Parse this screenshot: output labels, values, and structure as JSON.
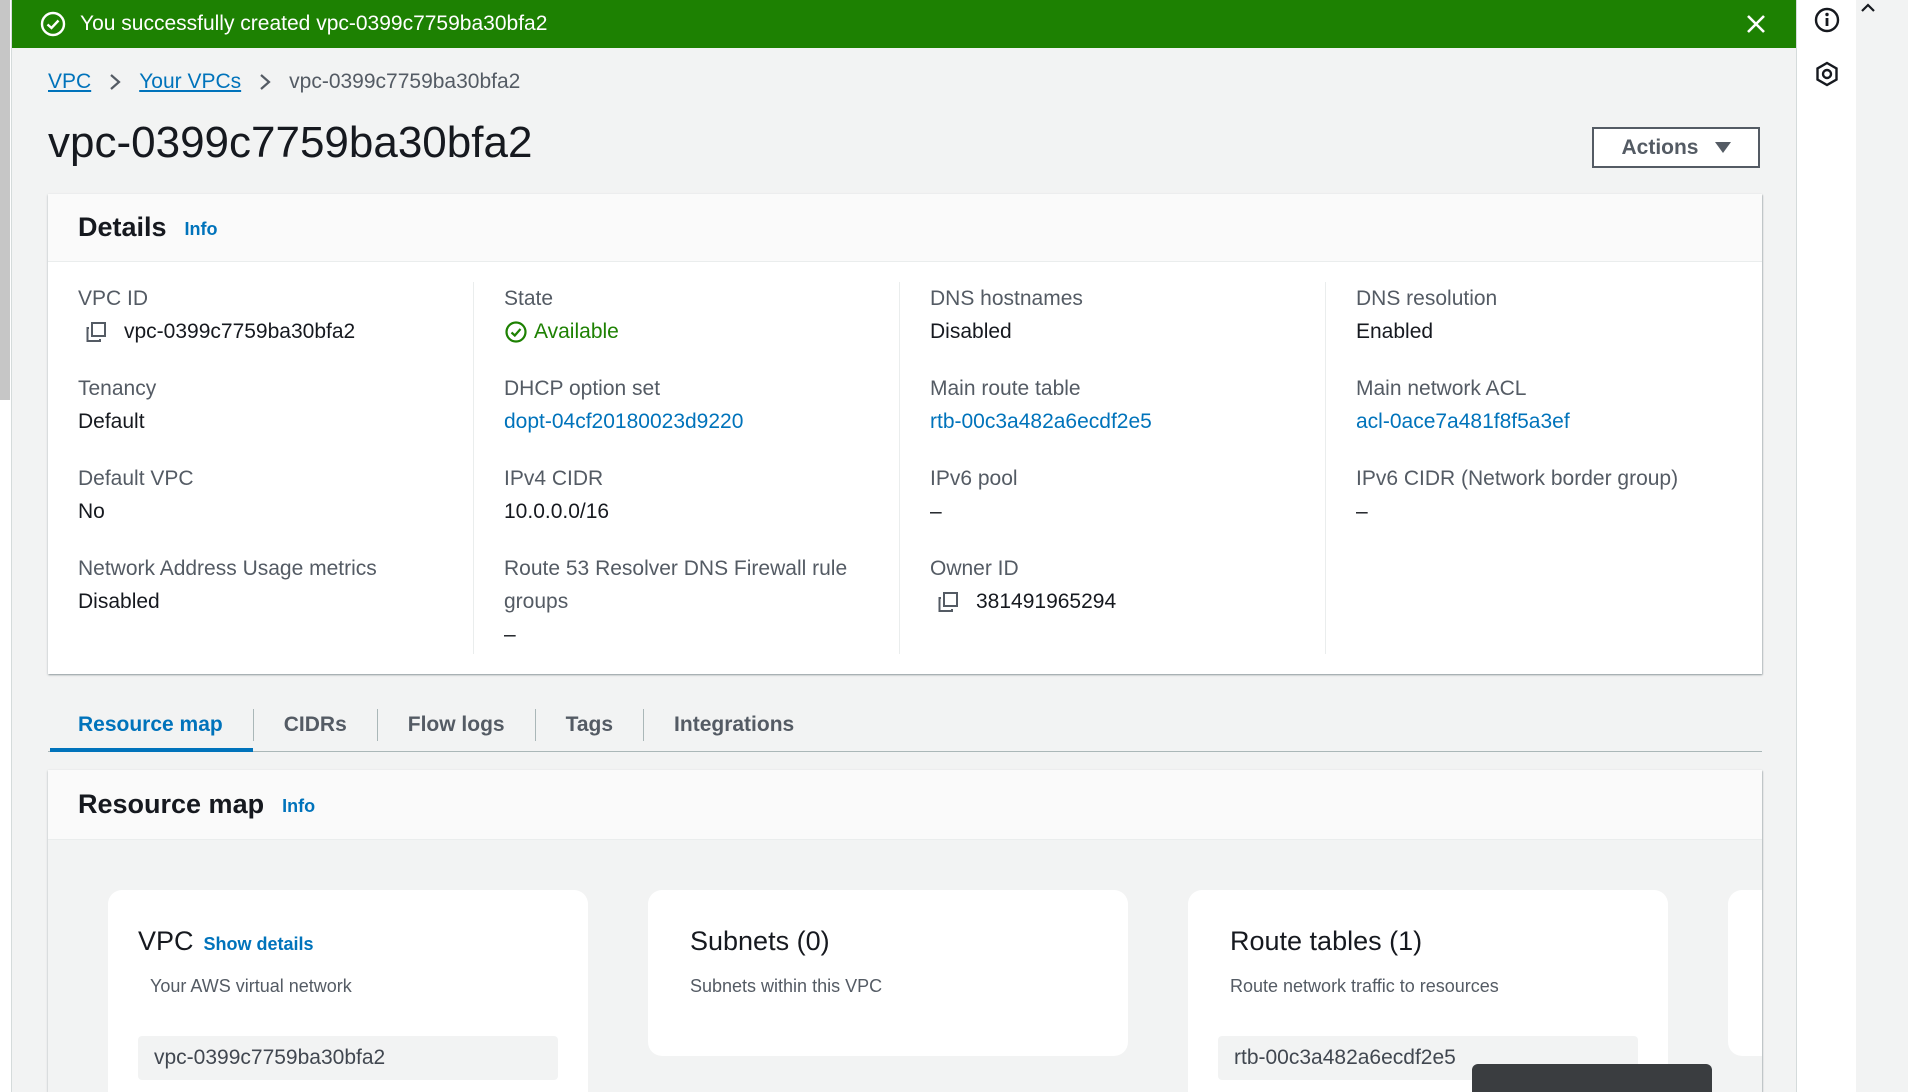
{
  "flash": {
    "message": "You successfully created vpc-0399c7759ba30bfa2",
    "color": "#1d8102"
  },
  "breadcrumb": {
    "items": [
      "VPC",
      "Your VPCs"
    ],
    "current": "vpc-0399c7759ba30bfa2"
  },
  "page": {
    "title": "vpc-0399c7759ba30bfa2",
    "actions_label": "Actions"
  },
  "details": {
    "heading": "Details",
    "info_label": "Info",
    "columns": [
      [
        {
          "label": "VPC ID",
          "value": "vpc-0399c7759ba30bfa2"
        },
        {
          "label": "Tenancy",
          "value": "Default"
        },
        {
          "label": "Default VPC",
          "value": "No"
        },
        {
          "label": "Network Address Usage metrics",
          "value": "Disabled"
        }
      ],
      [
        {
          "label": "State",
          "value": "Available"
        },
        {
          "label": "DHCP option set",
          "value": "dopt-04cf20180023d9220"
        },
        {
          "label": "IPv4 CIDR",
          "value": "10.0.0.0/16"
        },
        {
          "label": "Route 53 Resolver DNS Firewall rule groups",
          "value": "–"
        }
      ],
      [
        {
          "label": "DNS hostnames",
          "value": "Disabled"
        },
        {
          "label": "Main route table",
          "value": "rtb-00c3a482a6ecdf2e5"
        },
        {
          "label": "IPv6 pool",
          "value": "–"
        },
        {
          "label": "Owner ID",
          "value": "381491965294"
        }
      ],
      [
        {
          "label": "DNS resolution",
          "value": "Enabled"
        },
        {
          "label": "Main network ACL",
          "value": "acl-0ace7a481f8f5a3ef"
        },
        {
          "label": "IPv6 CIDR (Network border group)",
          "value": "–"
        }
      ]
    ]
  },
  "tabs": [
    "Resource map",
    "CIDRs",
    "Flow logs",
    "Tags",
    "Integrations"
  ],
  "resource_map": {
    "heading": "Resource map",
    "info_label": "Info",
    "cards": [
      {
        "title": "VPC",
        "link": "Show details",
        "subtitle": "Your AWS virtual network",
        "item": "vpc-0399c7759ba30bfa2"
      },
      {
        "title": "Subnets (0)",
        "subtitle": "Subnets within this VPC"
      },
      {
        "title": "Route tables (1)",
        "subtitle": "Route network traffic to resources",
        "item": "rtb-00c3a482a6ecdf2e5"
      }
    ]
  },
  "colors": {
    "link": "#0073bb",
    "success": "#1d8102",
    "text": "#16191f",
    "muted": "#545b64"
  }
}
